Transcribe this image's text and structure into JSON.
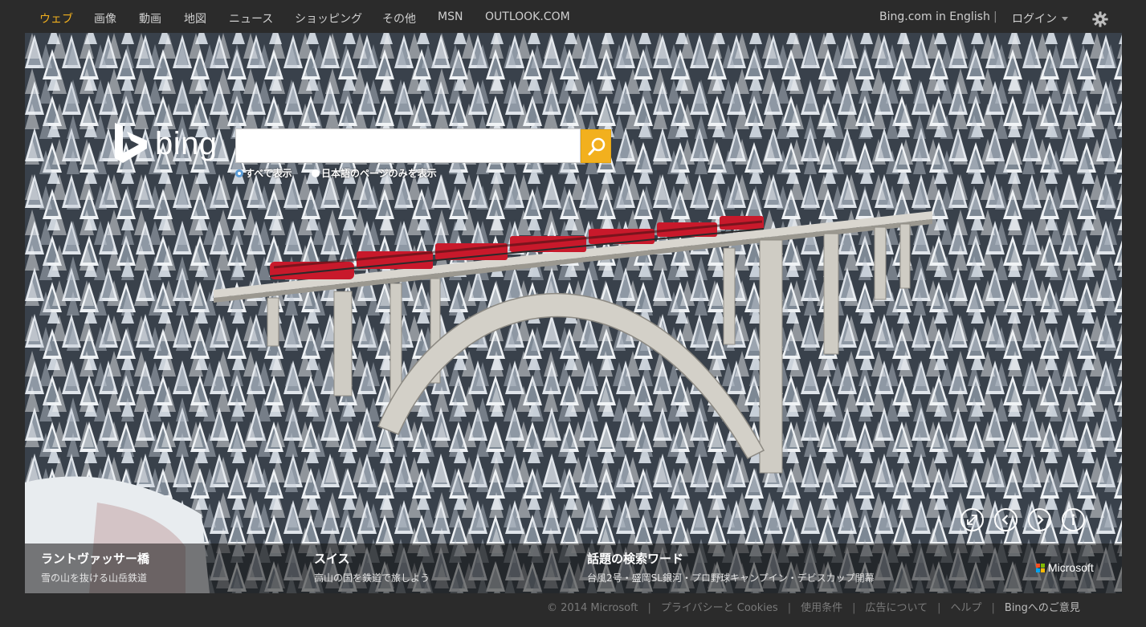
{
  "nav": {
    "items": [
      {
        "label": "ウェブ",
        "active": true
      },
      {
        "label": "画像",
        "active": false
      },
      {
        "label": "動画",
        "active": false
      },
      {
        "label": "地図",
        "active": false
      },
      {
        "label": "ニュース",
        "active": false
      },
      {
        "label": "ショッピング",
        "active": false
      },
      {
        "label": "その他",
        "active": false
      },
      {
        "label": "MSN",
        "active": false
      },
      {
        "label": "OUTLOOK.COM",
        "active": false
      }
    ],
    "english_link": "Bing.com in English",
    "separator": "|",
    "login_label": "ログイン",
    "settings_icon": "gear-icon"
  },
  "logo": {
    "text": "bing"
  },
  "search": {
    "value": "",
    "placeholder": "",
    "button_icon": "search-icon",
    "scope_all": "すべて表示",
    "scope_japanese": "日本語のページのみを表示"
  },
  "controls": {
    "fullscreen_icon": "expand-icon",
    "prev_icon": "chevron-left-icon",
    "next_icon": "chevron-right-icon",
    "info_icon": "info-icon"
  },
  "cards": [
    {
      "title": "ラントヴァッサー橋",
      "subtitle": "雪の山を抜ける山岳鉄道"
    },
    {
      "title": "スイス",
      "subtitle": "高山の国を鉄道で旅しよう"
    },
    {
      "title": "話題の検索ワード",
      "subtitle": "台風2号・盛岡SL銀河・プロ野球キャンプイン・デビスカップ開幕"
    }
  ],
  "microsoft_label": "Microsoft",
  "footer": {
    "copyright": "© 2014 Microsoft",
    "links": [
      "プライバシーと Cookies",
      "使用条件",
      "広告について",
      "ヘルプ"
    ],
    "feedback": "Bingへのご意見",
    "separator": "|"
  },
  "colors": {
    "accent": "#f2b01e",
    "page_bg": "#2b2b2b",
    "train_red": "#c8192b",
    "radio_selected": "#5b9bd5",
    "ms_red": "#f25022",
    "ms_green": "#7fba00",
    "ms_blue": "#00a4ef",
    "ms_yellow": "#ffb900"
  }
}
